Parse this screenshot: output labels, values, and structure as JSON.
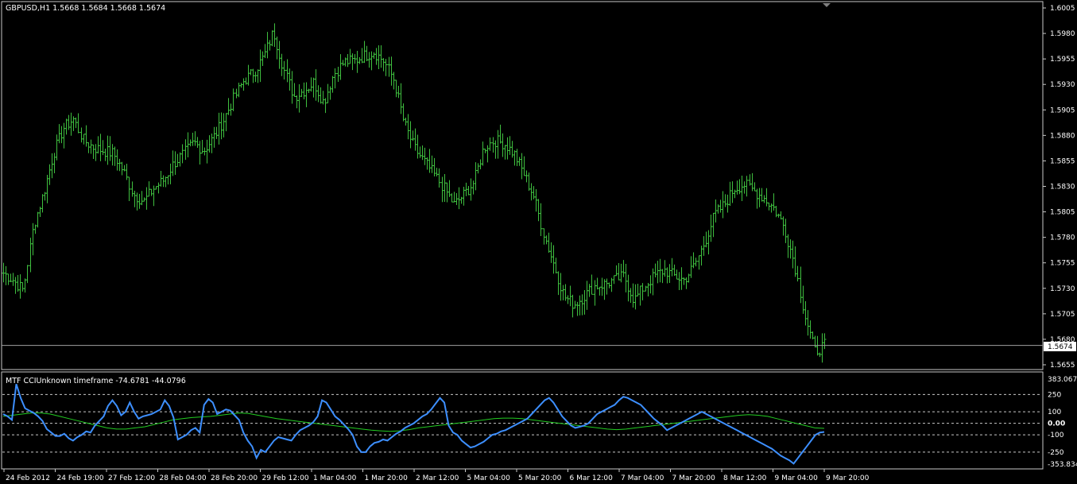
{
  "main": {
    "title": "GBPUSD,H1  1.5668 1.5684 1.5668 1.5674",
    "price_tag": "1.5674",
    "price_axis": [
      "1.6005",
      "1.5980",
      "1.5955",
      "1.5930",
      "1.5905",
      "1.5880",
      "1.5855",
      "1.5830",
      "1.5805",
      "1.5780",
      "1.5755",
      "1.5730",
      "1.5705",
      "1.5680",
      "1.5655"
    ],
    "current_price": 1.5674
  },
  "indicator": {
    "title": "MTF CCIUnknown timeframe -74.6781 -44.0796",
    "axis_labels": [
      "383.0676",
      "250",
      "100",
      "0.00",
      "-100",
      "-250",
      "-353.834"
    ],
    "cci_current": -74.6781,
    "signal_current": -44.0796
  },
  "time_axis": [
    "24 Feb 2012",
    "24 Feb 19:00",
    "27 Feb 12:00",
    "28 Feb 04:00",
    "28 Feb 20:00",
    "29 Feb 12:00",
    "1 Mar 04:00",
    "1 Mar 20:00",
    "2 Mar 12:00",
    "5 Mar 04:00",
    "5 Mar 20:00",
    "6 Mar 12:00",
    "7 Mar 04:00",
    "7 Mar 20:00",
    "8 Mar 12:00",
    "9 Mar 04:00",
    "9 Mar 20:00"
  ],
  "colors": {
    "background": "#000000",
    "bars": "#3fbf3f",
    "cci": "#3d8fff",
    "signal": "#22cc22",
    "grid": "#c0c0c0"
  },
  "chart_data": [
    {
      "type": "line",
      "title": "GBPUSD,H1",
      "ylim": [
        1.5655,
        1.6005
      ],
      "anchors_close": [
        1.5745,
        1.5738,
        1.5728,
        1.5792,
        1.5823,
        1.5862,
        1.5887,
        1.5896,
        1.5875,
        1.5868,
        1.5865,
        1.5862,
        1.5845,
        1.5822,
        1.5815,
        1.5828,
        1.5836,
        1.5852,
        1.5862,
        1.5873,
        1.5865,
        1.5878,
        1.5895,
        1.5916,
        1.5934,
        1.5942,
        1.5957,
        1.5982,
        1.5945,
        1.5918,
        1.5924,
        1.5932,
        1.5912,
        1.594,
        1.5952,
        1.5953,
        1.5958,
        1.5962,
        1.5953,
        1.5934,
        1.5892,
        1.5868,
        1.5855,
        1.5842,
        1.5828,
        1.5812,
        1.5822,
        1.5834,
        1.5868,
        1.5875,
        1.5872,
        1.5862,
        1.5842,
        1.582,
        1.5782,
        1.5752,
        1.5722,
        1.5714,
        1.5722,
        1.5732,
        1.5734,
        1.5738,
        1.5742,
        1.5718,
        1.5732,
        1.5742,
        1.5748,
        1.5742,
        1.5738,
        1.5752,
        1.5775,
        1.5802,
        1.5812,
        1.5828,
        1.5832,
        1.5825,
        1.5818,
        1.5808,
        1.579,
        1.5755,
        1.5705,
        1.5668,
        1.5674
      ]
    },
    {
      "type": "line",
      "title": "MTF CCIUnknown timeframe",
      "ylim": [
        -353.834,
        383.0676
      ],
      "series": [
        {
          "name": "CCI",
          "values": [
            80,
            60,
            30,
            340,
            220,
            130,
            110,
            90,
            60,
            20,
            -50,
            -80,
            -110,
            -110,
            -90,
            -130,
            -150,
            -120,
            -100,
            -70,
            -80,
            -20,
            20,
            60,
            150,
            200,
            150,
            70,
            100,
            180,
            100,
            40,
            60,
            70,
            80,
            100,
            120,
            200,
            150,
            50,
            -140,
            -120,
            -100,
            -60,
            -40,
            -80,
            160,
            210,
            180,
            80,
            100,
            120,
            110,
            70,
            30,
            -80,
            -150,
            -200,
            -300,
            -230,
            -250,
            -200,
            -150,
            -120,
            -130,
            -140,
            -150,
            -100,
            -60,
            -40,
            -20,
            10,
            60,
            200,
            180,
            120,
            60,
            30,
            -10,
            -50,
            -100,
            -200,
            -250,
            -250,
            -200,
            -170,
            -160,
            -140,
            -150,
            -120,
            -90,
            -70,
            -40,
            -20,
            0,
            30,
            60,
            80,
            120,
            170,
            220,
            180,
            -20,
            -80,
            -100,
            -150,
            -180,
            -210,
            -200,
            -180,
            -160,
            -130,
            -100,
            -90,
            -70,
            -60,
            -40,
            -20,
            0,
            20,
            40,
            80,
            120,
            160,
            200,
            220,
            180,
            120,
            60,
            20,
            -20,
            -40,
            -30,
            -20,
            0,
            40,
            80,
            100,
            120,
            140,
            160,
            200,
            230,
            220,
            200,
            180,
            160,
            120,
            80,
            40,
            10,
            -20,
            -60,
            -40,
            -20,
            0,
            20,
            40,
            60,
            80,
            100,
            80,
            60,
            40,
            20,
            0,
            -20,
            -40,
            -60,
            -80,
            -100,
            -120,
            -140,
            -160,
            -180,
            -200,
            -220,
            -250,
            -280,
            -300,
            -320,
            -350,
            -300,
            -250,
            -200,
            -150,
            -100,
            -80,
            -75
          ]
        },
        {
          "name": "Signal",
          "values": [
            60,
            70,
            80,
            90,
            90,
            80,
            60,
            40,
            20,
            0,
            -20,
            -40,
            -50,
            -50,
            -40,
            -30,
            -10,
            10,
            30,
            40,
            50,
            55,
            60,
            70,
            80,
            90,
            85,
            70,
            55,
            40,
            30,
            20,
            10,
            0,
            -10,
            -20,
            -30,
            -40,
            -50,
            -60,
            -65,
            -70,
            -65,
            -55,
            -40,
            -30,
            -20,
            -10,
            0,
            10,
            20,
            30,
            40,
            45,
            45,
            40,
            30,
            20,
            10,
            0,
            -10,
            -20,
            -30,
            -40,
            -50,
            -55,
            -50,
            -40,
            -30,
            -20,
            -10,
            0,
            10,
            20,
            30,
            40,
            50,
            60,
            70,
            75,
            70,
            60,
            40,
            20,
            0,
            -20,
            -40,
            -44
          ]
        }
      ]
    }
  ]
}
